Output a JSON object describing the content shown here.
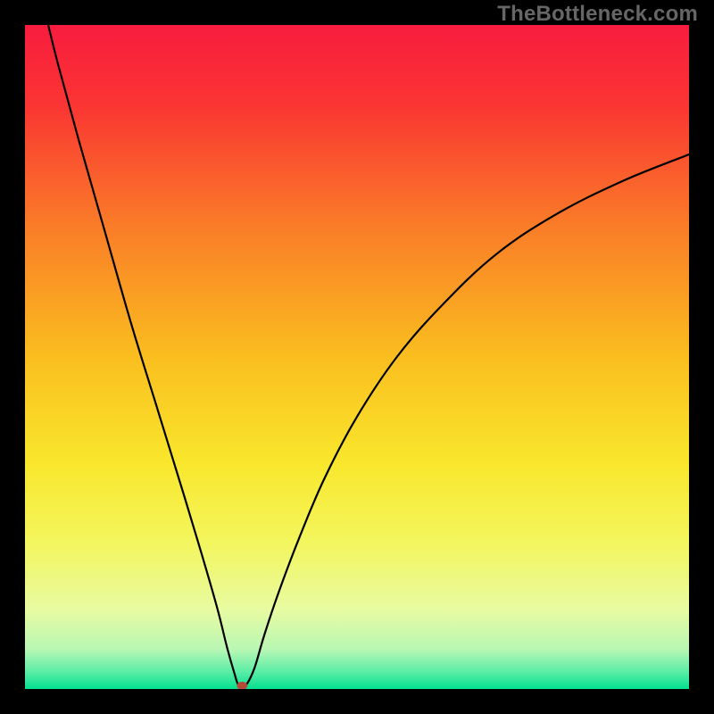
{
  "watermark": "TheBottleneck.com",
  "chart_data": {
    "type": "line",
    "title": "",
    "xlabel": "",
    "ylabel": "",
    "xlim": [
      0,
      100
    ],
    "ylim": [
      0,
      100
    ],
    "gradient_stops": [
      {
        "offset": 0.0,
        "color": "#f81c3f"
      },
      {
        "offset": 0.12,
        "color": "#fa3533"
      },
      {
        "offset": 0.3,
        "color": "#fa7b28"
      },
      {
        "offset": 0.5,
        "color": "#fabe1f"
      },
      {
        "offset": 0.66,
        "color": "#f9e72c"
      },
      {
        "offset": 0.78,
        "color": "#f3f65e"
      },
      {
        "offset": 0.88,
        "color": "#e8fba1"
      },
      {
        "offset": 0.94,
        "color": "#b9f7b4"
      },
      {
        "offset": 0.975,
        "color": "#58eda6"
      },
      {
        "offset": 1.0,
        "color": "#04e08f"
      }
    ],
    "series": [
      {
        "name": "bottleneck-curve",
        "x": [
          3.5,
          5,
          8,
          12,
          16,
          20,
          24,
          27,
          29,
          30.5,
          31.5,
          32.2,
          33.2,
          34.5,
          36,
          38,
          41,
          45,
          50,
          56,
          63,
          71,
          80,
          90,
          100
        ],
        "y": [
          100,
          94,
          83,
          69,
          55,
          42,
          29,
          19,
          12,
          6,
          2.5,
          0.5,
          0.5,
          3,
          8,
          14,
          22,
          31.5,
          41,
          50,
          58,
          65.5,
          71.5,
          76.5,
          80.5
        ]
      }
    ],
    "min_marker": {
      "x": 32.7,
      "y": 0.5
    }
  }
}
